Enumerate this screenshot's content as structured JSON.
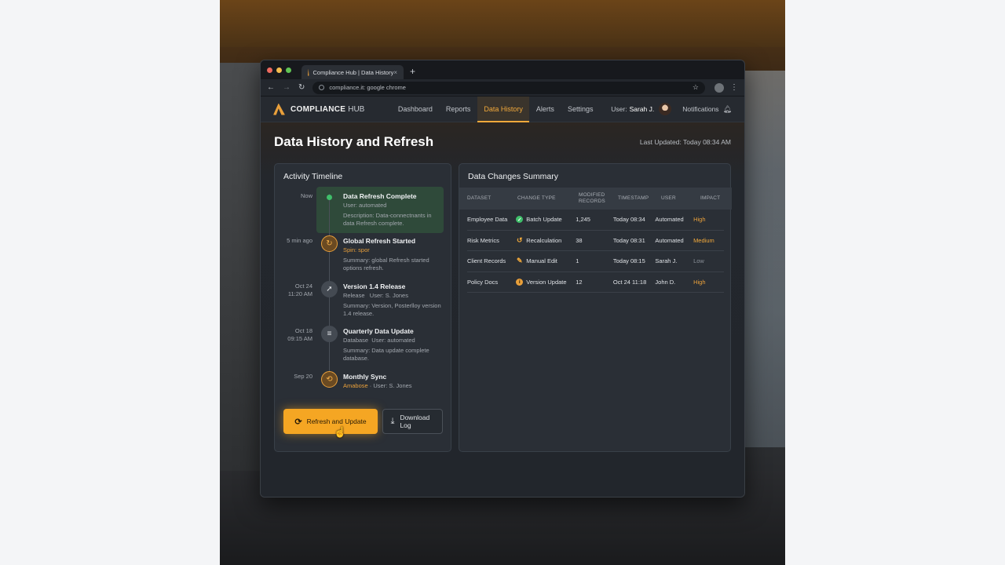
{
  "browser": {
    "tab_title": "Compliance Hub | Data History",
    "tab_close": "×",
    "new_tab": "+",
    "address": "compliance.it: google chrome"
  },
  "nav": {
    "brand_bold": "COMPLIANCE",
    "brand_light": "HUB",
    "links": [
      "Dashboard",
      "Reports",
      "Data History",
      "Alerts",
      "Settings"
    ],
    "active_link": "Data History",
    "user_label": "User:",
    "user_name": "Sarah J.",
    "notifications": "Notifications"
  },
  "page": {
    "title": "Data History and Refresh",
    "last_updated": "Last Updated: Today 08:34 AM"
  },
  "timeline": {
    "title": "Activity Timeline",
    "items": [
      {
        "time": "Now",
        "name": "Data Refresh Complete",
        "meta_a": "User:",
        "meta_b": "automated",
        "desc": "Description: Data-connectnants in data Refresh complete.",
        "icon": "green-dot-icon"
      },
      {
        "time": "5 min ago",
        "name": "Global Refresh Started",
        "meta_a": "Spin: spor",
        "meta_b": "",
        "desc": "Summary: global Refresh started options refresh.",
        "icon": "spinner-icon"
      },
      {
        "time": "Oct 24\n11:20 AM",
        "time1": "Oct 24",
        "time2": "11:20 AM",
        "name": "Version 1.4 Release",
        "meta_a": "Release",
        "meta_b": "User: S. Jones",
        "desc": "Summary: Version, Posterlloy version 1.4 release.",
        "icon": "rocket-icon"
      },
      {
        "time1": "Oct 18",
        "time2": "09:15 AM",
        "name": "Quarterly Data Update",
        "meta_a": "Database",
        "meta_b": "User: automated",
        "desc": "Summary: Data update complete database.",
        "icon": "database-icon"
      },
      {
        "time": "Sep 20",
        "name": "Monthly Sync",
        "meta_a": "Amabose",
        "meta_b": "· User: S. Jones",
        "desc": "",
        "icon": "sync-icon"
      }
    ],
    "refresh_button": "Refresh and Update",
    "download_button": "Download Log"
  },
  "summary": {
    "title": "Data Changes Summary",
    "columns": [
      "DATASET",
      "CHANGE TYPE",
      "MODIFIED RECORDS",
      "TIMESTAMP",
      "USER",
      "IMPACT"
    ],
    "rows": [
      {
        "dataset": "Employee Data",
        "change": "Batch Update",
        "records": "1,245",
        "timestamp": "Today 08:34",
        "user": "Automated",
        "impact": "High"
      },
      {
        "dataset": "Risk Metrics",
        "change": "Recalculation",
        "records": "38",
        "timestamp": "Today 08:31",
        "user": "Automated",
        "impact": "Medium"
      },
      {
        "dataset": "Client Records",
        "change": "Manual Edit",
        "records": "1",
        "timestamp": "Today 08:15",
        "user": "Sarah J.",
        "impact": "Low"
      },
      {
        "dataset": "Policy Docs",
        "change": "Version Update",
        "records": "12",
        "timestamp": "Oct 24 11:18",
        "user": "John D.",
        "impact": "High"
      }
    ]
  },
  "colors": {
    "accent": "#f5a623",
    "impact_high": "#e9a03b",
    "impact_medium": "#f2a93b",
    "impact_low": "#8a9098",
    "success": "#3fbf6a"
  }
}
